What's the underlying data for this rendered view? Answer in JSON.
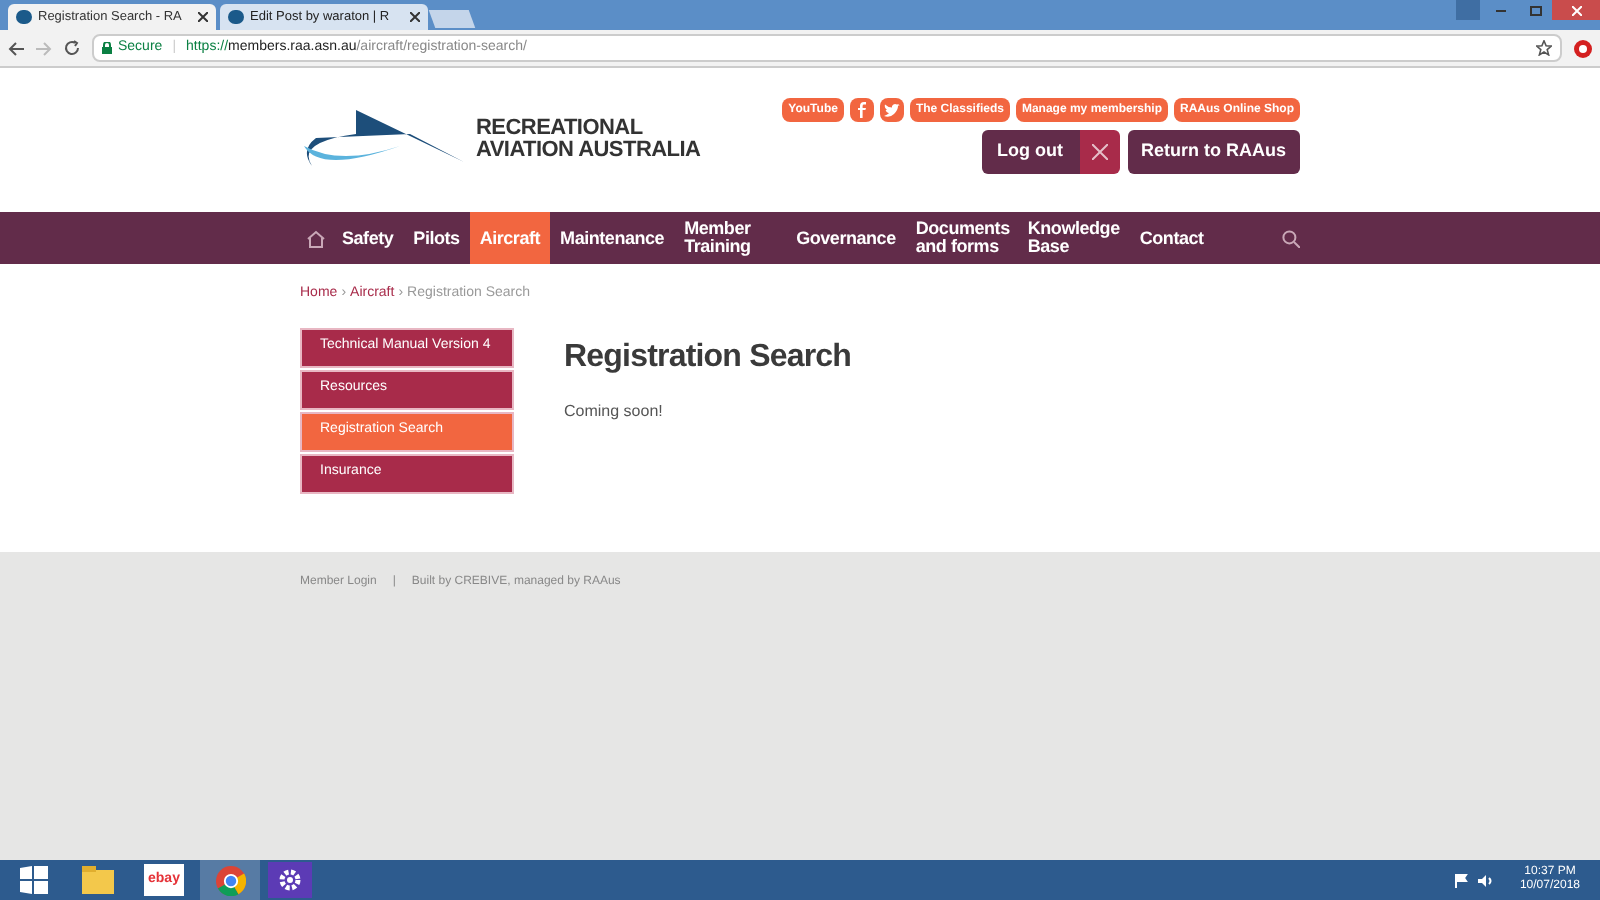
{
  "browser": {
    "tabs": [
      {
        "title": "Registration Search - RA",
        "selected": true
      },
      {
        "title": "Edit Post by waraton | R",
        "selected": false
      }
    ],
    "secure_label": "Secure",
    "divider": "|",
    "url": {
      "scheme": "https://",
      "host": "members.raa.asn.au",
      "path": "/aircraft/registration-search/"
    }
  },
  "header": {
    "logo": [
      "RECREATIONAL",
      "AVIATION AUSTRALIA"
    ],
    "top_links": [
      {
        "kind": "text",
        "label": "YouTube"
      },
      {
        "kind": "facebook"
      },
      {
        "kind": "twitter"
      },
      {
        "kind": "text",
        "label": "The Classifieds"
      },
      {
        "kind": "text",
        "label": "Manage my membership"
      },
      {
        "kind": "text",
        "label": "RAAus Online Shop"
      }
    ],
    "logout": "Log out",
    "return": "Return to RAAus"
  },
  "nav": [
    {
      "label": "Safety",
      "selected": false
    },
    {
      "label": "Pilots",
      "selected": false
    },
    {
      "label": "Aircraft",
      "selected": true
    },
    {
      "label": "Maintenance",
      "selected": false
    },
    {
      "label": "Member Training",
      "selected": false
    },
    {
      "label": "Governance",
      "selected": false
    },
    {
      "label": "Documents and forms",
      "selected": false
    },
    {
      "label": "Knowledge Base",
      "selected": false
    },
    {
      "label": "Contact",
      "selected": false
    }
  ],
  "breadcrumb": {
    "separator": "›",
    "items": [
      "Home",
      "Aircraft",
      "Registration Search"
    ]
  },
  "sidebar": [
    {
      "label": "Technical Manual Version 4",
      "selected": false
    },
    {
      "label": "Resources",
      "selected": false
    },
    {
      "label": "Registration Search",
      "selected": true
    },
    {
      "label": "Insurance",
      "selected": false
    }
  ],
  "content": {
    "title": "Registration Search",
    "text": "Coming soon!"
  },
  "footer": {
    "login": "Member Login",
    "sep": "|",
    "credit": "Built by CREBIVE, managed by RAAus"
  },
  "taskbar": {
    "apps": [
      {
        "kind": "windows"
      },
      {
        "kind": "folder"
      },
      {
        "kind": "ebay",
        "label": "ebay"
      },
      {
        "kind": "chrome"
      },
      {
        "kind": "gear"
      }
    ],
    "time": "10:37 PM",
    "date": "10/07/2018"
  }
}
